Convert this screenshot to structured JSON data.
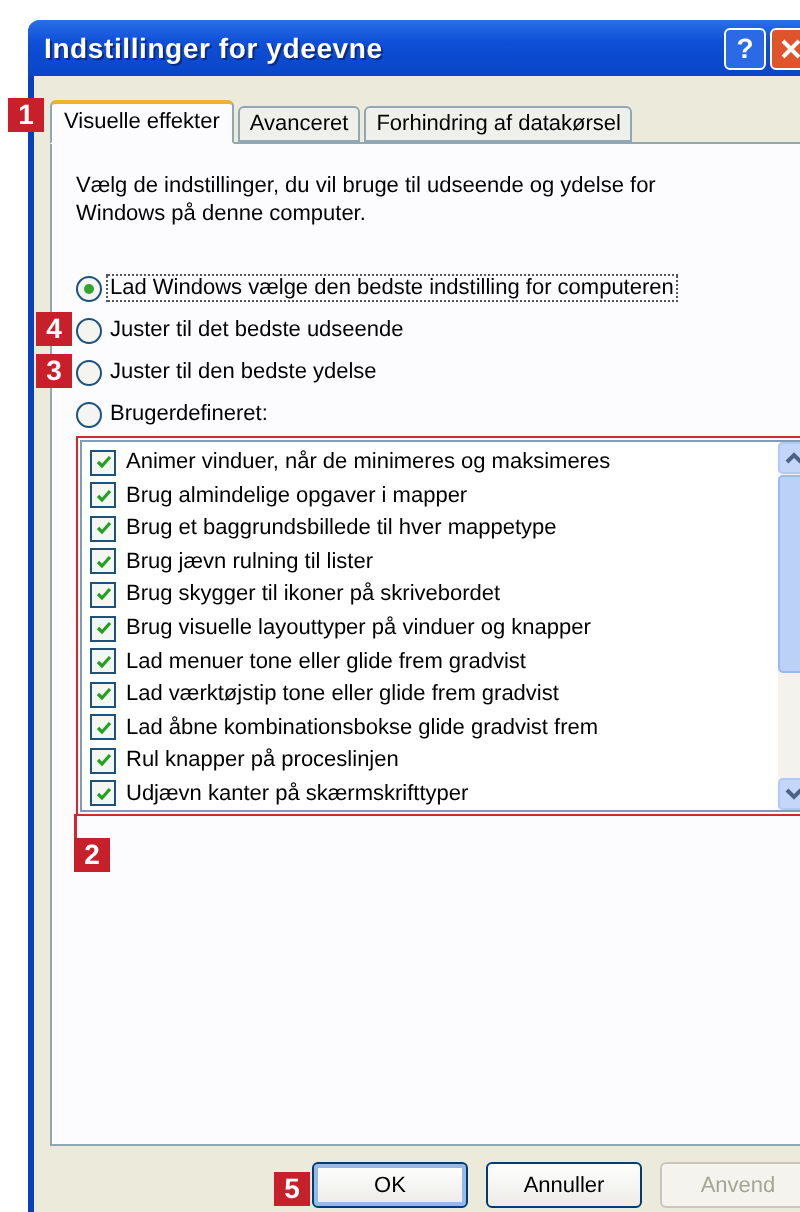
{
  "window": {
    "title": "Indstillinger for ydeevne",
    "help_button": "?"
  },
  "tabs": [
    {
      "label": "Visuelle effekter",
      "selected": true,
      "marker": "1"
    },
    {
      "label": "Avanceret",
      "selected": false
    },
    {
      "label": "Forhindring af datakørsel",
      "selected": false
    }
  ],
  "description": "Vælg de indstillinger, du vil bruge til udseende og ydelse for Windows på denne computer.",
  "options": [
    {
      "label": "Lad Windows vælge den bedste indstilling for computeren",
      "selected": true
    },
    {
      "label": "Juster til det bedste udseende",
      "selected": false,
      "marker": "4"
    },
    {
      "label": "Juster til den bedste ydelse",
      "selected": false,
      "marker": "3"
    },
    {
      "label": "Brugerdefineret:",
      "selected": false
    }
  ],
  "checklist": {
    "marker": "2",
    "items": [
      {
        "label": "Animer vinduer, når de minimeres og maksimeres",
        "checked": true
      },
      {
        "label": "Brug almindelige opgaver i mapper",
        "checked": true
      },
      {
        "label": "Brug et baggrundsbillede til hver mappetype",
        "checked": true
      },
      {
        "label": "Brug jævn rulning til lister",
        "checked": true
      },
      {
        "label": "Brug skygger til ikoner på skrivebordet",
        "checked": true
      },
      {
        "label": "Brug visuelle layouttyper på vinduer og knapper",
        "checked": true
      },
      {
        "label": "Lad menuer tone eller glide frem gradvist",
        "checked": true
      },
      {
        "label": "Lad værktøjstip tone eller glide frem gradvist",
        "checked": true
      },
      {
        "label": "Lad åbne kombinationsbokse glide gradvist frem",
        "checked": true
      },
      {
        "label": "Rul knapper på proceslinjen",
        "checked": true
      },
      {
        "label": "Udjævn kanter på skærmskrifttyper",
        "checked": true
      }
    ]
  },
  "buttons": [
    {
      "label": "OK",
      "disabled": false,
      "marker": "5"
    },
    {
      "label": "Annuller",
      "disabled": false
    },
    {
      "label": "Anvend",
      "disabled": true
    }
  ]
}
